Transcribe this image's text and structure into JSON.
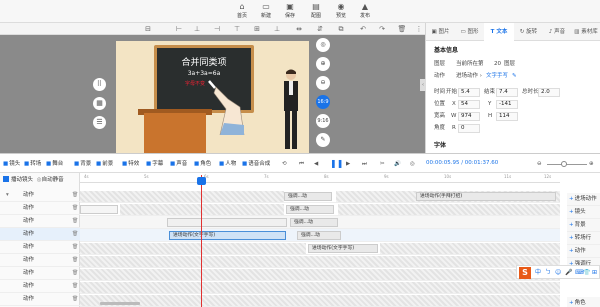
{
  "topbar": {
    "items": [
      {
        "label": "首页",
        "icon": "home-icon"
      },
      {
        "label": "新建",
        "icon": "new-file-icon"
      },
      {
        "label": "保存",
        "icon": "save-icon"
      },
      {
        "label": "配图",
        "icon": "image-icon"
      },
      {
        "label": "预览",
        "icon": "preview-icon"
      },
      {
        "label": "发布",
        "icon": "publish-icon"
      }
    ]
  },
  "props_panel": {
    "tabs": [
      "图片",
      "图形",
      "文本",
      "旋转",
      "声音",
      "素材库"
    ],
    "active_tab": "文本",
    "section_basic": "基本信息",
    "layer_label": "图层",
    "layer_value": "当前所在第",
    "layer_num": "20",
    "layer_unit": "图层",
    "action_label": "动作",
    "action_value": "进场动作 ›",
    "action_link": "文字手写",
    "time_label": "时间",
    "start_label": "开始",
    "start_value": "5.4",
    "end_label": "结束",
    "end_value": "7.4",
    "total_label": "总时长",
    "total_value": "2.0",
    "pos_label": "位置",
    "x_label": "X",
    "x_value": "54",
    "y_label": "Y",
    "y_value": "-141",
    "size_label": "宽高",
    "w_label": "W",
    "w_value": "974",
    "h_label": "H",
    "h_value": "114",
    "angle_label": "角度",
    "r_label": "R",
    "r_value": "0",
    "font_section": "字体"
  },
  "canvas": {
    "board_title": "合并同类项",
    "board_eq": "3a+3a=6a",
    "board_note": "字母不变",
    "ratio": "16:9",
    "duration": "9:16"
  },
  "tl_toolbar": {
    "items": [
      {
        "label": "镜头",
        "icon": "camera-icon"
      },
      {
        "label": "转场",
        "icon": "transition-icon"
      },
      {
        "label": "舞台",
        "icon": "stage-icon"
      },
      {
        "label": "背景",
        "icon": "background-icon"
      },
      {
        "label": "前景",
        "icon": "foreground-icon"
      },
      {
        "label": "特效",
        "icon": "effects-icon"
      },
      {
        "label": "字幕",
        "icon": "subtitle-icon"
      },
      {
        "label": "声音",
        "icon": "sound-icon"
      },
      {
        "label": "角色",
        "icon": "role-icon"
      },
      {
        "label": "人物",
        "icon": "person-icon"
      },
      {
        "label": "语音合成",
        "icon": "tts-icon"
      }
    ],
    "time": "00:00:05.95 / 00:01:37.60"
  },
  "timeline": {
    "header_checkbox": "播动镜头",
    "auto_mute": "自动静音",
    "ruler_ticks": [
      "4s",
      "5s",
      "6s",
      "7s",
      "8s",
      "9s",
      "10s",
      "11s",
      "12s"
    ],
    "rows": [
      {
        "name": "动作",
        "expanded": true
      },
      {
        "name": "动作"
      },
      {
        "name": "动作"
      },
      {
        "name": "动作",
        "selected": true
      },
      {
        "name": "动作"
      },
      {
        "name": "动作"
      },
      {
        "name": "动作"
      },
      {
        "name": "动作"
      },
      {
        "name": "动作"
      },
      {
        "name": "动作"
      }
    ],
    "clips": [
      {
        "label": "强调...动",
        "row": 0
      },
      {
        "label": "进场动作(手拜打招)",
        "row": 0
      },
      {
        "label": "强调...动",
        "row": 1
      },
      {
        "label": "强调...动",
        "row": 2
      },
      {
        "label": "进场动作(文字手写)",
        "row": 3,
        "selected": true
      },
      {
        "label": "强调...动",
        "row": 3
      },
      {
        "label": "进场动作(文字手写)",
        "row": 4
      }
    ],
    "add_buttons": [
      "进场动作",
      "镜头",
      "背景",
      "转场行",
      "动作",
      "强调行",
      "角色"
    ]
  },
  "ime": {
    "logo": "S",
    "items": [
      "中",
      "ㄅ",
      "☺",
      "🎤",
      "⌨",
      "👕",
      "⊞"
    ]
  }
}
